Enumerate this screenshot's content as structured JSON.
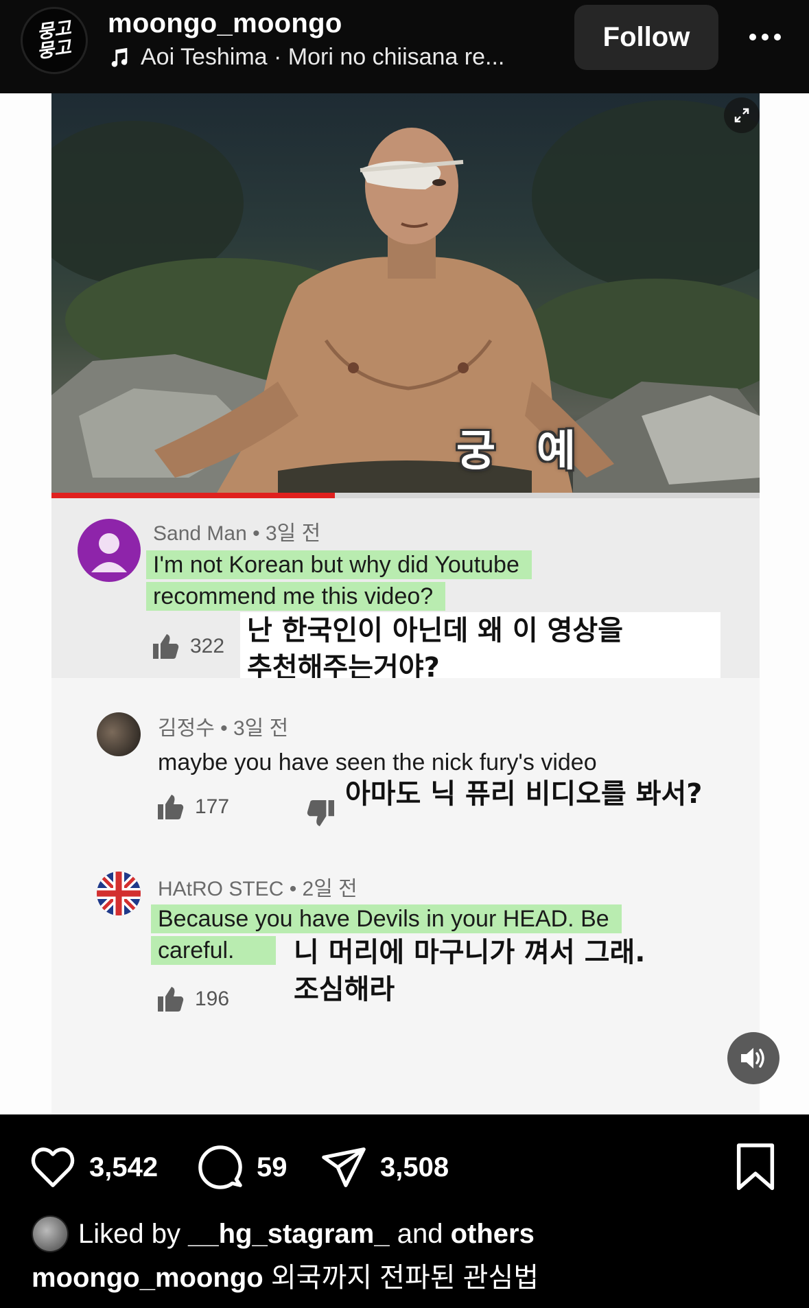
{
  "header": {
    "avatar_text": [
      "뭉고",
      "뭉고"
    ],
    "username": "moongo_moongo",
    "audio": "Aoi Teshima · Mori no chiisana re...",
    "follow_label": "Follow"
  },
  "media": {
    "video_subtitle": "궁예",
    "comments": [
      {
        "author": "Sand Man",
        "time": "3일 전",
        "text": "I'm not Korean but why did Youtube recommend me this video?",
        "translation_line1": "난 한국인이 아닌데 왜 이 영상을",
        "translation_line2": "추천해주는거야?",
        "likes": "322"
      },
      {
        "author": "김정수",
        "time": "3일 전",
        "text": "maybe you have seen the nick fury's video",
        "translation_line1": "아마도 닉 퓨리 비디오를 봐서?",
        "likes": "177"
      },
      {
        "author": "HAtRO STEC",
        "time": "2일 전",
        "text_line1": "Because you have Devils in your HEAD. Be",
        "text_line2": "careful.",
        "translation_line1": "니 머리에 마구니가 껴서 그래.",
        "translation_line2": "조심해라",
        "likes": "196"
      }
    ]
  },
  "actions": {
    "likes": "3,542",
    "comments": "59",
    "shares": "3,508"
  },
  "liked_by": {
    "prefix": "Liked by",
    "user": "__hg_stagram_",
    "middle": "and",
    "others": "others"
  },
  "caption": {
    "username": "moongo_moongo",
    "text": "외국까지 전파된 관심법"
  },
  "colors": {
    "highlight": "#b9ecb0",
    "progress": "#e0201e",
    "avatar_purple": "#8e24aa"
  }
}
